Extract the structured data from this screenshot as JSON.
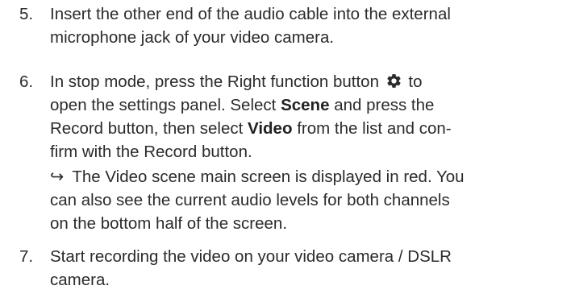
{
  "steps": [
    {
      "number": "5.",
      "lines": [
        "Insert the other end of the audio cable into the external",
        "microphone jack of your video camera."
      ]
    },
    {
      "number": "6.",
      "line1_before": "In stop mode, press the Right function button",
      "line1_after": "to",
      "line2": "open the settings panel. Select",
      "line2_bold": "Scene",
      "line2_after": "and press the",
      "line3": "Record button, then select",
      "line3_bold": "Video",
      "line3_after": "from the list and con-",
      "line4": "firm with the Record button.",
      "result_arrow": "↪",
      "result_lines": [
        "The Video scene main screen is displayed in red. You",
        "can also see the current audio levels for both channels",
        "on the bottom half of the screen."
      ],
      "icon": "gear-icon"
    },
    {
      "number": "7.",
      "lines": [
        "Start recording the video on your video camera / DSLR",
        "camera."
      ]
    }
  ]
}
